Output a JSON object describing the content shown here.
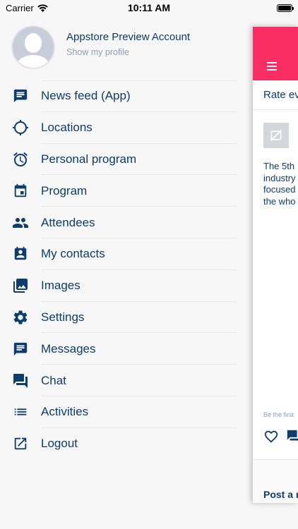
{
  "status_bar": {
    "carrier": "Carrier",
    "time": "10:11 AM"
  },
  "profile": {
    "name": "Appstore Preview Account",
    "subtitle": "Show my profile"
  },
  "menu": {
    "items": [
      {
        "label": "News feed (App)",
        "icon": "news-feed-icon"
      },
      {
        "label": "Locations",
        "icon": "crosshair-icon"
      },
      {
        "label": "Personal program",
        "icon": "alarm-clock-icon"
      },
      {
        "label": "Program",
        "icon": "calendar-icon"
      },
      {
        "label": "Attendees",
        "icon": "people-icon"
      },
      {
        "label": "My contacts",
        "icon": "contact-card-icon"
      },
      {
        "label": "Images",
        "icon": "images-icon"
      },
      {
        "label": "Settings",
        "icon": "gear-icon"
      },
      {
        "label": "Messages",
        "icon": "message-icon"
      },
      {
        "label": "Chat",
        "icon": "chat-icon"
      },
      {
        "label": "Activities",
        "icon": "list-icon"
      },
      {
        "label": "Logout",
        "icon": "logout-icon"
      }
    ]
  },
  "background_app": {
    "rate_text": "Rate ev",
    "feed_lines": [
      "The 5th",
      "industry",
      "focused",
      "the who"
    ],
    "be_first": "Be the first",
    "post_text": "Post a m"
  },
  "colors": {
    "accent": "#fb2e63",
    "text": "#0d3c6e",
    "muted": "#8fa0b6"
  }
}
